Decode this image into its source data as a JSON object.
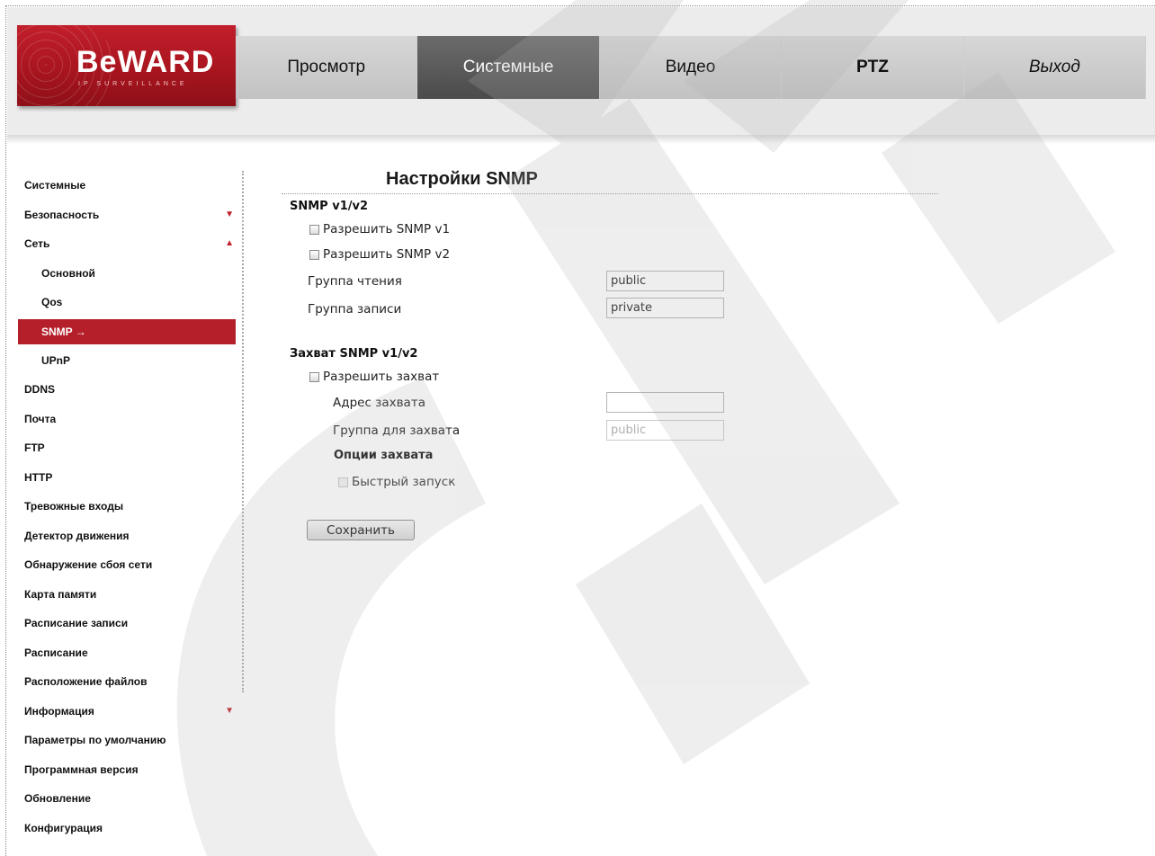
{
  "logo": {
    "text": "BeWARD",
    "subtitle": "IP SURVEILLANCE"
  },
  "nav": [
    {
      "label": "Просмотр"
    },
    {
      "label": "Системные"
    },
    {
      "label": "Видео"
    },
    {
      "label": "PTZ"
    },
    {
      "label": "Выход"
    }
  ],
  "sidebar": {
    "items": [
      {
        "label": "Системные"
      },
      {
        "label": "Безопасность"
      },
      {
        "label": "Сеть"
      },
      {
        "label": "Основной"
      },
      {
        "label": "Qos"
      },
      {
        "label": "SNMP →"
      },
      {
        "label": "UPnP"
      },
      {
        "label": "DDNS"
      },
      {
        "label": "Почта"
      },
      {
        "label": "FTP"
      },
      {
        "label": "HTTP"
      },
      {
        "label": "Тревожные входы"
      },
      {
        "label": "Детектор движения"
      },
      {
        "label": "Обнаружение сбоя сети"
      },
      {
        "label": "Карта памяти"
      },
      {
        "label": "Расписание записи"
      },
      {
        "label": "Расписание"
      },
      {
        "label": "Расположение файлов"
      },
      {
        "label": "Информация"
      },
      {
        "label": "Параметры по умолчанию"
      },
      {
        "label": "Программная версия"
      },
      {
        "label": "Обновление"
      },
      {
        "label": "Конфигурация"
      }
    ]
  },
  "main": {
    "title": "Настройки SNMP",
    "snmp": {
      "heading": "SNMP v1/v2",
      "enable_v1": "Разрешить SNMP v1",
      "enable_v2": "Разрешить SNMP v2",
      "read_group_label": "Группа чтения",
      "read_group_value": "public",
      "write_group_label": "Группа записи",
      "write_group_value": "private"
    },
    "trap": {
      "heading": "Захват SNMP v1/v2",
      "enable": "Разрешить захват",
      "address_label": "Адрес захвата",
      "address_value": "",
      "group_label": "Группа для захвата",
      "group_value": "public",
      "options_heading": "Опции захвата",
      "fast_start": "Быстрый запуск"
    },
    "save_label": "Сохранить"
  },
  "colors": {
    "accent": "#b51f2a",
    "nav_active": "#555555",
    "nav_bg": "#cccccc"
  }
}
